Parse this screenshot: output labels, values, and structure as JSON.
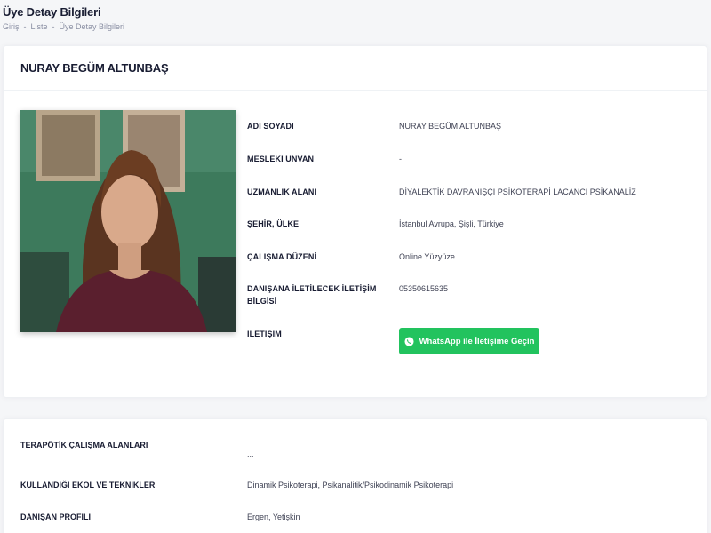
{
  "page": {
    "title": "Üye Detay Bilgileri",
    "breadcrumb": [
      "Giriş",
      "Liste",
      "Üye Detay Bilgileri"
    ]
  },
  "profile": {
    "name": "NURAY BEGÜM ALTUNBAŞ",
    "fields": [
      {
        "label": "ADI SOYADI",
        "value": "NURAY BEGÜM ALTUNBAŞ"
      },
      {
        "label": "MESLEKİ ÜNVAN",
        "value": "-"
      },
      {
        "label": "UZMANLIK ALANI",
        "value": "DİYALEKTİK DAVRANIŞÇI PSİKOTERAPİ LACANCI PSİKANALİZ"
      },
      {
        "label": "ŞEHİR, ÜLKE",
        "value": "İstanbul Avrupa, Şişli, Türkiye"
      },
      {
        "label": "ÇALIŞMA DÜZENİ",
        "value": "Online Yüzyüze"
      },
      {
        "label": "DANIŞANA İLETİLECEK İLETİŞİM BİLGİSİ",
        "value": "05350615635"
      },
      {
        "label": "İLETİŞİM",
        "value": ""
      }
    ],
    "whatsapp_label": "WhatsApp ile İletişime Geçin"
  },
  "extra": {
    "fields": [
      {
        "label": "TERAPÖTİK ÇALIŞMA ALANLARI",
        "value": "..."
      },
      {
        "label": "KULLANDIĞI EKOL VE TEKNİKLER",
        "value": "Dinamik Psikoterapi, Psikanalitik/Psikodinamik Psikoterapi"
      },
      {
        "label": "DANIŞAN PROFİLİ",
        "value": "Ergen, Yetişkin"
      }
    ]
  },
  "colors": {
    "whatsapp_green": "#22c35e",
    "heading": "#181c32",
    "muted": "#8a8fa3"
  },
  "icons": {
    "whatsapp": "whatsapp-icon"
  }
}
